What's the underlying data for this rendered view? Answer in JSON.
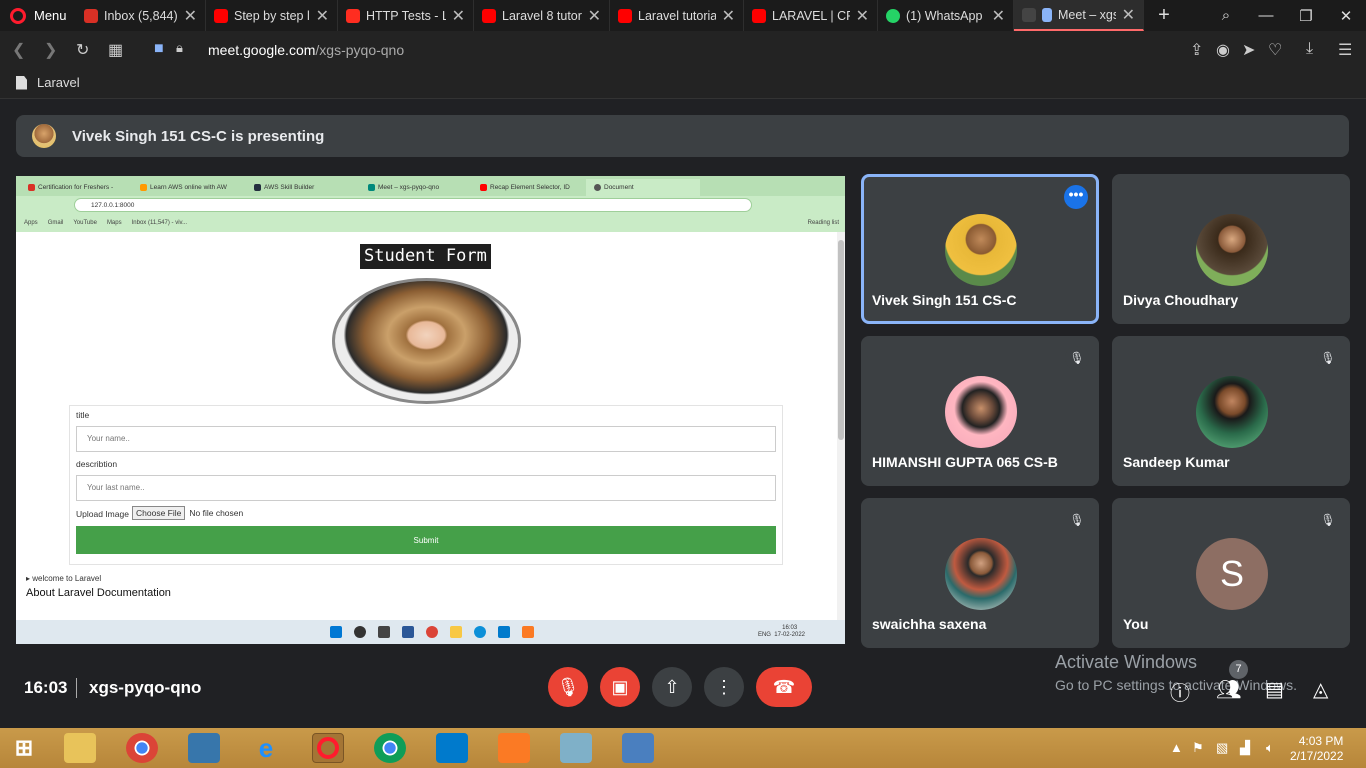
{
  "browser": {
    "menu_label": "Menu",
    "tabs": [
      {
        "label": "Inbox (5,844) -",
        "color": "#d93025"
      },
      {
        "label": "Step by step le",
        "color": "#ff0000"
      },
      {
        "label": "HTTP Tests - La",
        "color": "#ff2d20"
      },
      {
        "label": "Laravel 8 tutori",
        "color": "#ff0000"
      },
      {
        "label": "Laravel tutorial",
        "color": "#ff0000"
      },
      {
        "label": "LARAVEL | CRU",
        "color": "#ff0000"
      },
      {
        "label": "(1) WhatsApp",
        "color": "#25d366"
      },
      {
        "label": "Meet – xgs-",
        "color": "#00897b"
      }
    ],
    "url_domain": "meet.google.com",
    "url_path": "/xgs-pyqo-qno",
    "bookmark": "Laravel"
  },
  "meet": {
    "presenting_text": "Vivek Singh 151 CS-C is presenting",
    "meeting_time": "16:03",
    "meeting_code": "xgs-pyqo-qno",
    "people_count": "7",
    "activate_line1": "Activate Windows",
    "activate_line2": "Go to PC settings to activate Windows.",
    "participants": [
      {
        "name": "Vivek Singh 151 CS-C",
        "muted": false,
        "presenting": true
      },
      {
        "name": "Divya Choudhary",
        "muted": false
      },
      {
        "name": "HIMANSHI GUPTA 065 CS-B",
        "muted": true
      },
      {
        "name": "Sandeep Kumar",
        "muted": true
      },
      {
        "name": "swaichha saxena",
        "muted": true
      },
      {
        "name": "You",
        "muted": true,
        "initial": "S"
      }
    ]
  },
  "shared_screen": {
    "tabs": [
      "Certification for Freshers -",
      "Learn AWS online with AW",
      "AWS Skill Builder",
      "Meet – xgs-pyqo-qno",
      "Recap Element Selector, ID",
      "Document"
    ],
    "url": "127.0.0.1:8000",
    "bookmarks": [
      "Apps",
      "Gmail",
      "YouTube",
      "Maps",
      "Inbox (11,547) - viv..."
    ],
    "reading_list": "Reading list",
    "form_title": "Student Form",
    "title_label": "title",
    "title_placeholder": "Your name..",
    "desc_label": "describtion",
    "desc_placeholder": "Your last name..",
    "upload_label": "Upload Image",
    "choose_btn": "Choose File",
    "no_file": "No file chosen",
    "submit": "Submit",
    "footer_summary": "▸ welcome to Laravel",
    "footer_link": "About Laravel Documentation",
    "tray_lang": "ENG",
    "tray_time": "16:03",
    "tray_date": "17-02-2022"
  },
  "taskbar": {
    "time": "4:03 PM",
    "date": "2/17/2022"
  }
}
